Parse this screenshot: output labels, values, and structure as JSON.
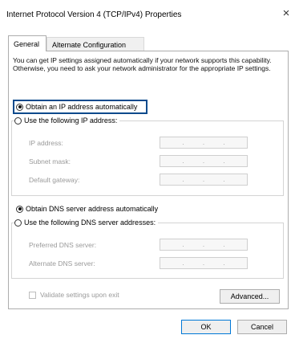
{
  "window": {
    "title": "Internet Protocol Version 4 (TCP/IPv4) Properties",
    "close_glyph": "×"
  },
  "tabs": [
    {
      "label": "General",
      "selected": true
    },
    {
      "label": "Alternate Configuration",
      "selected": false
    }
  ],
  "general": {
    "intro": "You can get IP settings assigned automatically if your network supports this capability. Otherwise, you need to ask your network administrator for the appropriate IP settings.",
    "ip_mode": {
      "auto_label": "Obtain an IP address automatically",
      "manual_label": "Use the following IP address:",
      "selected": "auto"
    },
    "ip_fields": [
      {
        "label": "IP address:",
        "value": ".   .   ."
      },
      {
        "label": "Subnet mask:",
        "value": ".   .   ."
      },
      {
        "label": "Default gateway:",
        "value": ".   .   ."
      }
    ],
    "dns_mode": {
      "auto_label": "Obtain DNS server address automatically",
      "manual_label": "Use the following DNS server addresses:",
      "selected": "auto"
    },
    "dns_fields": [
      {
        "label": "Preferred DNS server:",
        "value": ".   .   ."
      },
      {
        "label": "Alternate DNS server:",
        "value": ".   .   ."
      }
    ],
    "validate_label": "Validate settings upon exit",
    "validate_checked": false,
    "advanced_label": "Advanced..."
  },
  "footer": {
    "ok_label": "OK",
    "cancel_label": "Cancel"
  }
}
